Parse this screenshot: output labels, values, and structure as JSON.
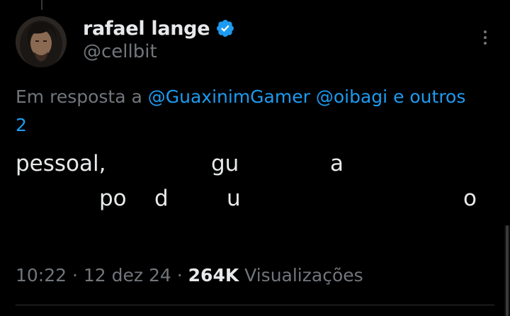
{
  "author": {
    "display_name": "rafael lange",
    "handle": "@cellbit",
    "verified": true,
    "verified_color": "#1d9bf0",
    "avatar_icon": "user-avatar"
  },
  "reply_context": {
    "prefix": "Em resposta a",
    "mentions": [
      "@GuaxinimGamer",
      "@oibagi"
    ],
    "suffix": "e outros",
    "extra_count": "2"
  },
  "tweet": {
    "line1": [
      "pessoal,",
      "gu",
      "a"
    ],
    "line2": [
      "po",
      "d",
      "u",
      "o"
    ]
  },
  "meta": {
    "time": "10:22",
    "separator": "·",
    "date": "12 dez 24",
    "views_count": "264K",
    "views_label": "Visualizações"
  },
  "colors": {
    "background": "#000000",
    "text_primary": "#e7e9ea",
    "text_secondary": "#71767b",
    "link": "#1d9bf0"
  }
}
